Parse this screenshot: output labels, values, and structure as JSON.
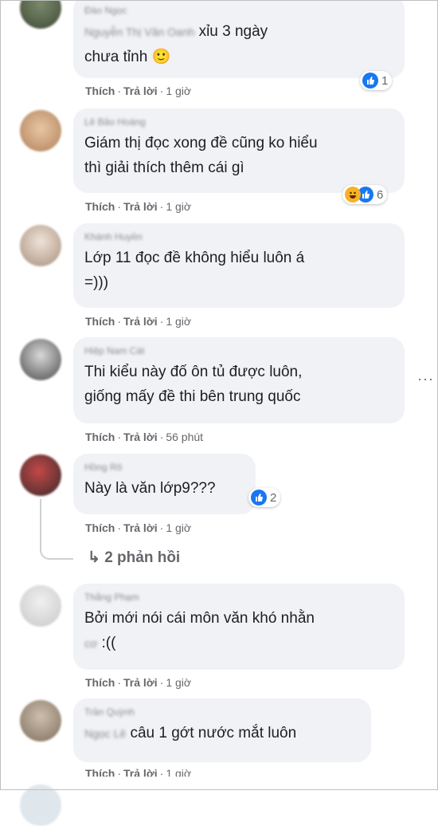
{
  "comments": [
    {
      "name": "Đào Ngọc",
      "mention": "Nguyễn Thị Vân Oanh",
      "text": "xỉu 3 ngày\nchưa tỉnh 🙂",
      "like": "Thích",
      "reply": "Trả lời",
      "time": "1 giờ",
      "reaction_count": "1"
    },
    {
      "name": "Lê Bảo Hoàng",
      "text": "Giám thị đọc xong đề cũng ko hiểu\nthì giải thích thêm cái gì",
      "like": "Thích",
      "reply": "Trả lời",
      "time": "1 giờ",
      "reaction_count": "6"
    },
    {
      "name": "Khánh Huyền",
      "text": "Lớp 11 đọc đề không hiểu luôn á\n=)))",
      "like": "Thích",
      "reply": "Trả lời",
      "time": "1 giờ"
    },
    {
      "name": "Hiệp Nam Cát",
      "text": "Thi kiểu này đố ôn tủ được luôn,\ngiống mấy đề thi bên trung quốc",
      "like": "Thích",
      "reply": "Trả lời",
      "time": "56 phút"
    },
    {
      "name": "Hồng Rô",
      "text": "Này là văn lớp9???",
      "like": "Thích",
      "reply": "Trả lời",
      "time": "1 giờ",
      "reaction_count": "2",
      "replies": "2 phản hồi"
    },
    {
      "name": "Thắng Phạm",
      "text": "Bởi mới nói cái môn văn khó nhằn",
      "mention": "cơ",
      "text2": ":((",
      "like": "Thích",
      "reply": "Trả lời",
      "time": "1 giờ"
    },
    {
      "name": "Trần Quỳnh",
      "mention": "Ngọc Lê",
      "text": "câu 1 gớt nước mắt luôn",
      "like": "Thích",
      "reply": "Trả lời",
      "time": "1 giờ"
    }
  ],
  "more_icon": "more-horizontal-icon",
  "colors": {
    "bubble": "#f0f2f5",
    "like": "#1877f2",
    "meta": "#65676b"
  }
}
